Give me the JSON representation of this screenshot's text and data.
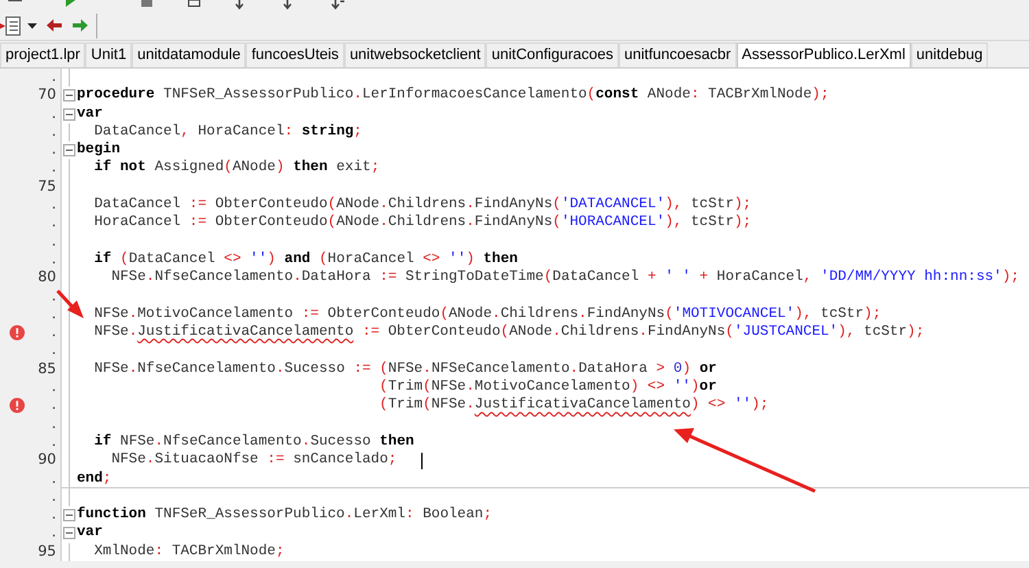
{
  "tabs": [
    {
      "label": "project1.lpr",
      "selected": false
    },
    {
      "label": "Unit1",
      "selected": false
    },
    {
      "label": "unitdatamodule",
      "selected": false
    },
    {
      "label": "funcoesUteis",
      "selected": false
    },
    {
      "label": "unitwebsocketclient",
      "selected": false
    },
    {
      "label": "unitConfiguracoes",
      "selected": false
    },
    {
      "label": "unitfuncoesacbr",
      "selected": false
    },
    {
      "label": "AssessorPublico.LerXml",
      "selected": true
    },
    {
      "label": "unitdebug",
      "selected": false
    }
  ],
  "editor": {
    "blocks": [
      {
        "lines": [
          {
            "number": ".",
            "fold": false,
            "error": false
          },
          {
            "number": "70",
            "fold": true,
            "error": false,
            "tokens": [
              {
                "kind": "keyword",
                "text": "procedure"
              },
              {
                "kind": "ident",
                "text": " TNFSeR_AssessorPublico"
              },
              {
                "kind": "symbol",
                "text": "."
              },
              {
                "kind": "ident",
                "text": "LerInformacoesCancelamento"
              },
              {
                "kind": "symbol",
                "text": "("
              },
              {
                "kind": "keyword",
                "text": "const"
              },
              {
                "kind": "ident",
                "text": " ANode"
              },
              {
                "kind": "symbol",
                "text": ":"
              },
              {
                "kind": "ident",
                "text": " TACBrXmlNode"
              },
              {
                "kind": "symbol",
                "text": ");"
              }
            ]
          },
          {
            "number": ".",
            "fold": true,
            "error": false,
            "tokens": [
              {
                "kind": "keyword",
                "text": "var"
              }
            ]
          },
          {
            "number": ".",
            "fold": false,
            "error": false,
            "tokens": [
              {
                "kind": "ident",
                "text": "  DataCancel"
              },
              {
                "kind": "symbol",
                "text": ","
              },
              {
                "kind": "ident",
                "text": " HoraCancel"
              },
              {
                "kind": "symbol",
                "text": ":"
              },
              {
                "kind": "keyword",
                "text": " string"
              },
              {
                "kind": "symbol",
                "text": ";"
              }
            ]
          },
          {
            "number": ".",
            "fold": true,
            "error": false,
            "tokens": [
              {
                "kind": "keyword",
                "text": "begin"
              }
            ]
          },
          {
            "number": ".",
            "fold": false,
            "error": false,
            "tokens": [
              {
                "kind": "keyword",
                "text": "  if not"
              },
              {
                "kind": "ident",
                "text": " Assigned"
              },
              {
                "kind": "symbol",
                "text": "("
              },
              {
                "kind": "ident",
                "text": "ANode"
              },
              {
                "kind": "symbol",
                "text": ")"
              },
              {
                "kind": "keyword",
                "text": " then"
              },
              {
                "kind": "ident",
                "text": " exit"
              },
              {
                "kind": "symbol",
                "text": ";"
              }
            ]
          },
          {
            "number": "75",
            "fold": false,
            "error": false
          },
          {
            "number": ".",
            "fold": false,
            "error": false,
            "tokens": [
              {
                "kind": "ident",
                "text": "  DataCancel "
              },
              {
                "kind": "symbol",
                "text": ":="
              },
              {
                "kind": "ident",
                "text": " ObterConteudo"
              },
              {
                "kind": "symbol",
                "text": "("
              },
              {
                "kind": "ident",
                "text": "ANode"
              },
              {
                "kind": "symbol",
                "text": "."
              },
              {
                "kind": "ident",
                "text": "Childrens"
              },
              {
                "kind": "symbol",
                "text": "."
              },
              {
                "kind": "ident",
                "text": "FindAnyNs"
              },
              {
                "kind": "symbol",
                "text": "("
              },
              {
                "kind": "string",
                "text": "'DATACANCEL'"
              },
              {
                "kind": "symbol",
                "text": "),"
              },
              {
                "kind": "ident",
                "text": " tcStr"
              },
              {
                "kind": "symbol",
                "text": ");"
              }
            ]
          },
          {
            "number": ".",
            "fold": false,
            "error": false,
            "tokens": [
              {
                "kind": "ident",
                "text": "  HoraCancel "
              },
              {
                "kind": "symbol",
                "text": ":="
              },
              {
                "kind": "ident",
                "text": " ObterConteudo"
              },
              {
                "kind": "symbol",
                "text": "("
              },
              {
                "kind": "ident",
                "text": "ANode"
              },
              {
                "kind": "symbol",
                "text": "."
              },
              {
                "kind": "ident",
                "text": "Childrens"
              },
              {
                "kind": "symbol",
                "text": "."
              },
              {
                "kind": "ident",
                "text": "FindAnyNs"
              },
              {
                "kind": "symbol",
                "text": "("
              },
              {
                "kind": "string",
                "text": "'HORACANCEL'"
              },
              {
                "kind": "symbol",
                "text": "),"
              },
              {
                "kind": "ident",
                "text": " tcStr"
              },
              {
                "kind": "symbol",
                "text": ");"
              }
            ]
          },
          {
            "number": ".",
            "fold": false,
            "error": false
          },
          {
            "number": ".",
            "fold": false,
            "error": false,
            "tokens": [
              {
                "kind": "keyword",
                "text": "  if"
              },
              {
                "kind": "symbol",
                "text": " ("
              },
              {
                "kind": "ident",
                "text": "DataCancel "
              },
              {
                "kind": "symbol",
                "text": "<>"
              },
              {
                "kind": "string",
                "text": " ''"
              },
              {
                "kind": "symbol",
                "text": ")"
              },
              {
                "kind": "keyword",
                "text": " and"
              },
              {
                "kind": "symbol",
                "text": " ("
              },
              {
                "kind": "ident",
                "text": "HoraCancel "
              },
              {
                "kind": "symbol",
                "text": "<>"
              },
              {
                "kind": "string",
                "text": " ''"
              },
              {
                "kind": "symbol",
                "text": ")"
              },
              {
                "kind": "keyword",
                "text": " then"
              }
            ]
          },
          {
            "number": "80",
            "fold": false,
            "error": false,
            "tokens": [
              {
                "kind": "ident",
                "text": "    NFSe"
              },
              {
                "kind": "symbol",
                "text": "."
              },
              {
                "kind": "ident",
                "text": "NfseCancelamento"
              },
              {
                "kind": "symbol",
                "text": "."
              },
              {
                "kind": "ident",
                "text": "DataHora "
              },
              {
                "kind": "symbol",
                "text": ":="
              },
              {
                "kind": "ident",
                "text": " StringToDateTime"
              },
              {
                "kind": "symbol",
                "text": "("
              },
              {
                "kind": "ident",
                "text": "DataCancel "
              },
              {
                "kind": "symbol",
                "text": "+"
              },
              {
                "kind": "string",
                "text": " ' '"
              },
              {
                "kind": "symbol",
                "text": " +"
              },
              {
                "kind": "ident",
                "text": " HoraCancel"
              },
              {
                "kind": "symbol",
                "text": ","
              },
              {
                "kind": "string",
                "text": " 'DD/MM/YYYY hh:nn:ss'"
              },
              {
                "kind": "symbol",
                "text": ");"
              }
            ]
          },
          {
            "number": ".",
            "fold": false,
            "error": false
          },
          {
            "number": ".",
            "fold": false,
            "error": false,
            "tokens": [
              {
                "kind": "ident",
                "text": "  NFSe"
              },
              {
                "kind": "symbol",
                "text": "."
              },
              {
                "kind": "ident",
                "text": "MotivoCancelamento "
              },
              {
                "kind": "symbol",
                "text": ":="
              },
              {
                "kind": "ident",
                "text": " ObterConteudo"
              },
              {
                "kind": "symbol",
                "text": "("
              },
              {
                "kind": "ident",
                "text": "ANode"
              },
              {
                "kind": "symbol",
                "text": "."
              },
              {
                "kind": "ident",
                "text": "Childrens"
              },
              {
                "kind": "symbol",
                "text": "."
              },
              {
                "kind": "ident",
                "text": "FindAnyNs"
              },
              {
                "kind": "symbol",
                "text": "("
              },
              {
                "kind": "string",
                "text": "'MOTIVOCANCEL'"
              },
              {
                "kind": "symbol",
                "text": "),"
              },
              {
                "kind": "ident",
                "text": " tcStr"
              },
              {
                "kind": "symbol",
                "text": ");"
              }
            ]
          },
          {
            "number": ".",
            "fold": false,
            "error": true,
            "tokens": [
              {
                "kind": "ident",
                "text": "  NFSe"
              },
              {
                "kind": "symbol",
                "text": "."
              },
              {
                "kind": "ident",
                "text": "JustificativaCancelamento",
                "error": true
              },
              {
                "kind": "symbol",
                "text": " :="
              },
              {
                "kind": "ident",
                "text": " ObterConteudo"
              },
              {
                "kind": "symbol",
                "text": "("
              },
              {
                "kind": "ident",
                "text": "ANode"
              },
              {
                "kind": "symbol",
                "text": "."
              },
              {
                "kind": "ident",
                "text": "Childrens"
              },
              {
                "kind": "symbol",
                "text": "."
              },
              {
                "kind": "ident",
                "text": "FindAnyNs"
              },
              {
                "kind": "symbol",
                "text": "("
              },
              {
                "kind": "string",
                "text": "'JUSTCANCEL'"
              },
              {
                "kind": "symbol",
                "text": "),"
              },
              {
                "kind": "ident",
                "text": " tcStr"
              },
              {
                "kind": "symbol",
                "text": ");"
              }
            ]
          },
          {
            "number": ".",
            "fold": false,
            "error": false
          },
          {
            "number": "85",
            "fold": false,
            "error": false,
            "tokens": [
              {
                "kind": "ident",
                "text": "  NFSe"
              },
              {
                "kind": "symbol",
                "text": "."
              },
              {
                "kind": "ident",
                "text": "NfseCancelamento"
              },
              {
                "kind": "symbol",
                "text": "."
              },
              {
                "kind": "ident",
                "text": "Sucesso "
              },
              {
                "kind": "symbol",
                "text": ":= ("
              },
              {
                "kind": "ident",
                "text": "NFSe"
              },
              {
                "kind": "symbol",
                "text": "."
              },
              {
                "kind": "ident",
                "text": "NFSeCancelamento"
              },
              {
                "kind": "symbol",
                "text": "."
              },
              {
                "kind": "ident",
                "text": "DataHora "
              },
              {
                "kind": "symbol",
                "text": ">"
              },
              {
                "kind": "number",
                "text": " 0"
              },
              {
                "kind": "symbol",
                "text": ")"
              },
              {
                "kind": "keyword",
                "text": " or"
              }
            ]
          },
          {
            "number": ".",
            "fold": false,
            "error": false,
            "tokens": [
              {
                "kind": "symbol",
                "text": "                                   ("
              },
              {
                "kind": "ident",
                "text": "Trim"
              },
              {
                "kind": "symbol",
                "text": "("
              },
              {
                "kind": "ident",
                "text": "NFSe"
              },
              {
                "kind": "symbol",
                "text": "."
              },
              {
                "kind": "ident",
                "text": "MotivoCancelamento"
              },
              {
                "kind": "symbol",
                "text": ") <>"
              },
              {
                "kind": "string",
                "text": " ''"
              },
              {
                "kind": "symbol",
                "text": ")"
              },
              {
                "kind": "keyword",
                "text": "or"
              }
            ]
          },
          {
            "number": ".",
            "fold": false,
            "error": true,
            "tokens": [
              {
                "kind": "symbol",
                "text": "                                   ("
              },
              {
                "kind": "ident",
                "text": "Trim"
              },
              {
                "kind": "symbol",
                "text": "("
              },
              {
                "kind": "ident",
                "text": "NFSe"
              },
              {
                "kind": "symbol",
                "text": "."
              },
              {
                "kind": "ident",
                "text": "JustificativaCancelamento",
                "error": true
              },
              {
                "kind": "symbol",
                "text": ") <>"
              },
              {
                "kind": "string",
                "text": " ''"
              },
              {
                "kind": "symbol",
                "text": ");"
              }
            ]
          },
          {
            "number": ".",
            "fold": false,
            "error": false
          },
          {
            "number": ".",
            "fold": false,
            "error": false,
            "tokens": [
              {
                "kind": "keyword",
                "text": "  if"
              },
              {
                "kind": "ident",
                "text": " NFSe"
              },
              {
                "kind": "symbol",
                "text": "."
              },
              {
                "kind": "ident",
                "text": "NfseCancelamento"
              },
              {
                "kind": "symbol",
                "text": "."
              },
              {
                "kind": "ident",
                "text": "Sucesso "
              },
              {
                "kind": "keyword",
                "text": "then"
              }
            ]
          },
          {
            "number": "90",
            "fold": false,
            "error": false,
            "cursor": true,
            "tokens": [
              {
                "kind": "ident",
                "text": "    NFSe"
              },
              {
                "kind": "symbol",
                "text": "."
              },
              {
                "kind": "ident",
                "text": "SituacaoNfse "
              },
              {
                "kind": "symbol",
                "text": ":="
              },
              {
                "kind": "ident",
                "text": " snCancelado"
              },
              {
                "kind": "symbol",
                "text": ";"
              }
            ]
          },
          {
            "number": ".",
            "fold": false,
            "error": false,
            "tokens": [
              {
                "kind": "keyword",
                "text": "end"
              },
              {
                "kind": "symbol",
                "text": ";"
              }
            ]
          }
        ]
      },
      {
        "lines": [
          {
            "number": ".",
            "fold": false,
            "error": false
          },
          {
            "number": ".",
            "fold": true,
            "error": false,
            "tokens": [
              {
                "kind": "keyword",
                "text": "function"
              },
              {
                "kind": "ident",
                "text": " TNFSeR_AssessorPublico"
              },
              {
                "kind": "symbol",
                "text": "."
              },
              {
                "kind": "ident",
                "text": "LerXml"
              },
              {
                "kind": "symbol",
                "text": ":"
              },
              {
                "kind": "ident",
                "text": " Boolean"
              },
              {
                "kind": "symbol",
                "text": ";"
              }
            ]
          },
          {
            "number": ".",
            "fold": true,
            "error": false,
            "tokens": [
              {
                "kind": "keyword",
                "text": "var"
              }
            ]
          },
          {
            "number": "95",
            "fold": false,
            "error": false,
            "tokens": [
              {
                "kind": "ident",
                "text": "  XmlNode"
              },
              {
                "kind": "symbol",
                "text": ":"
              },
              {
                "kind": "ident",
                "text": " TACBrXmlNode"
              },
              {
                "kind": "symbol",
                "text": ";"
              }
            ]
          }
        ]
      }
    ]
  }
}
